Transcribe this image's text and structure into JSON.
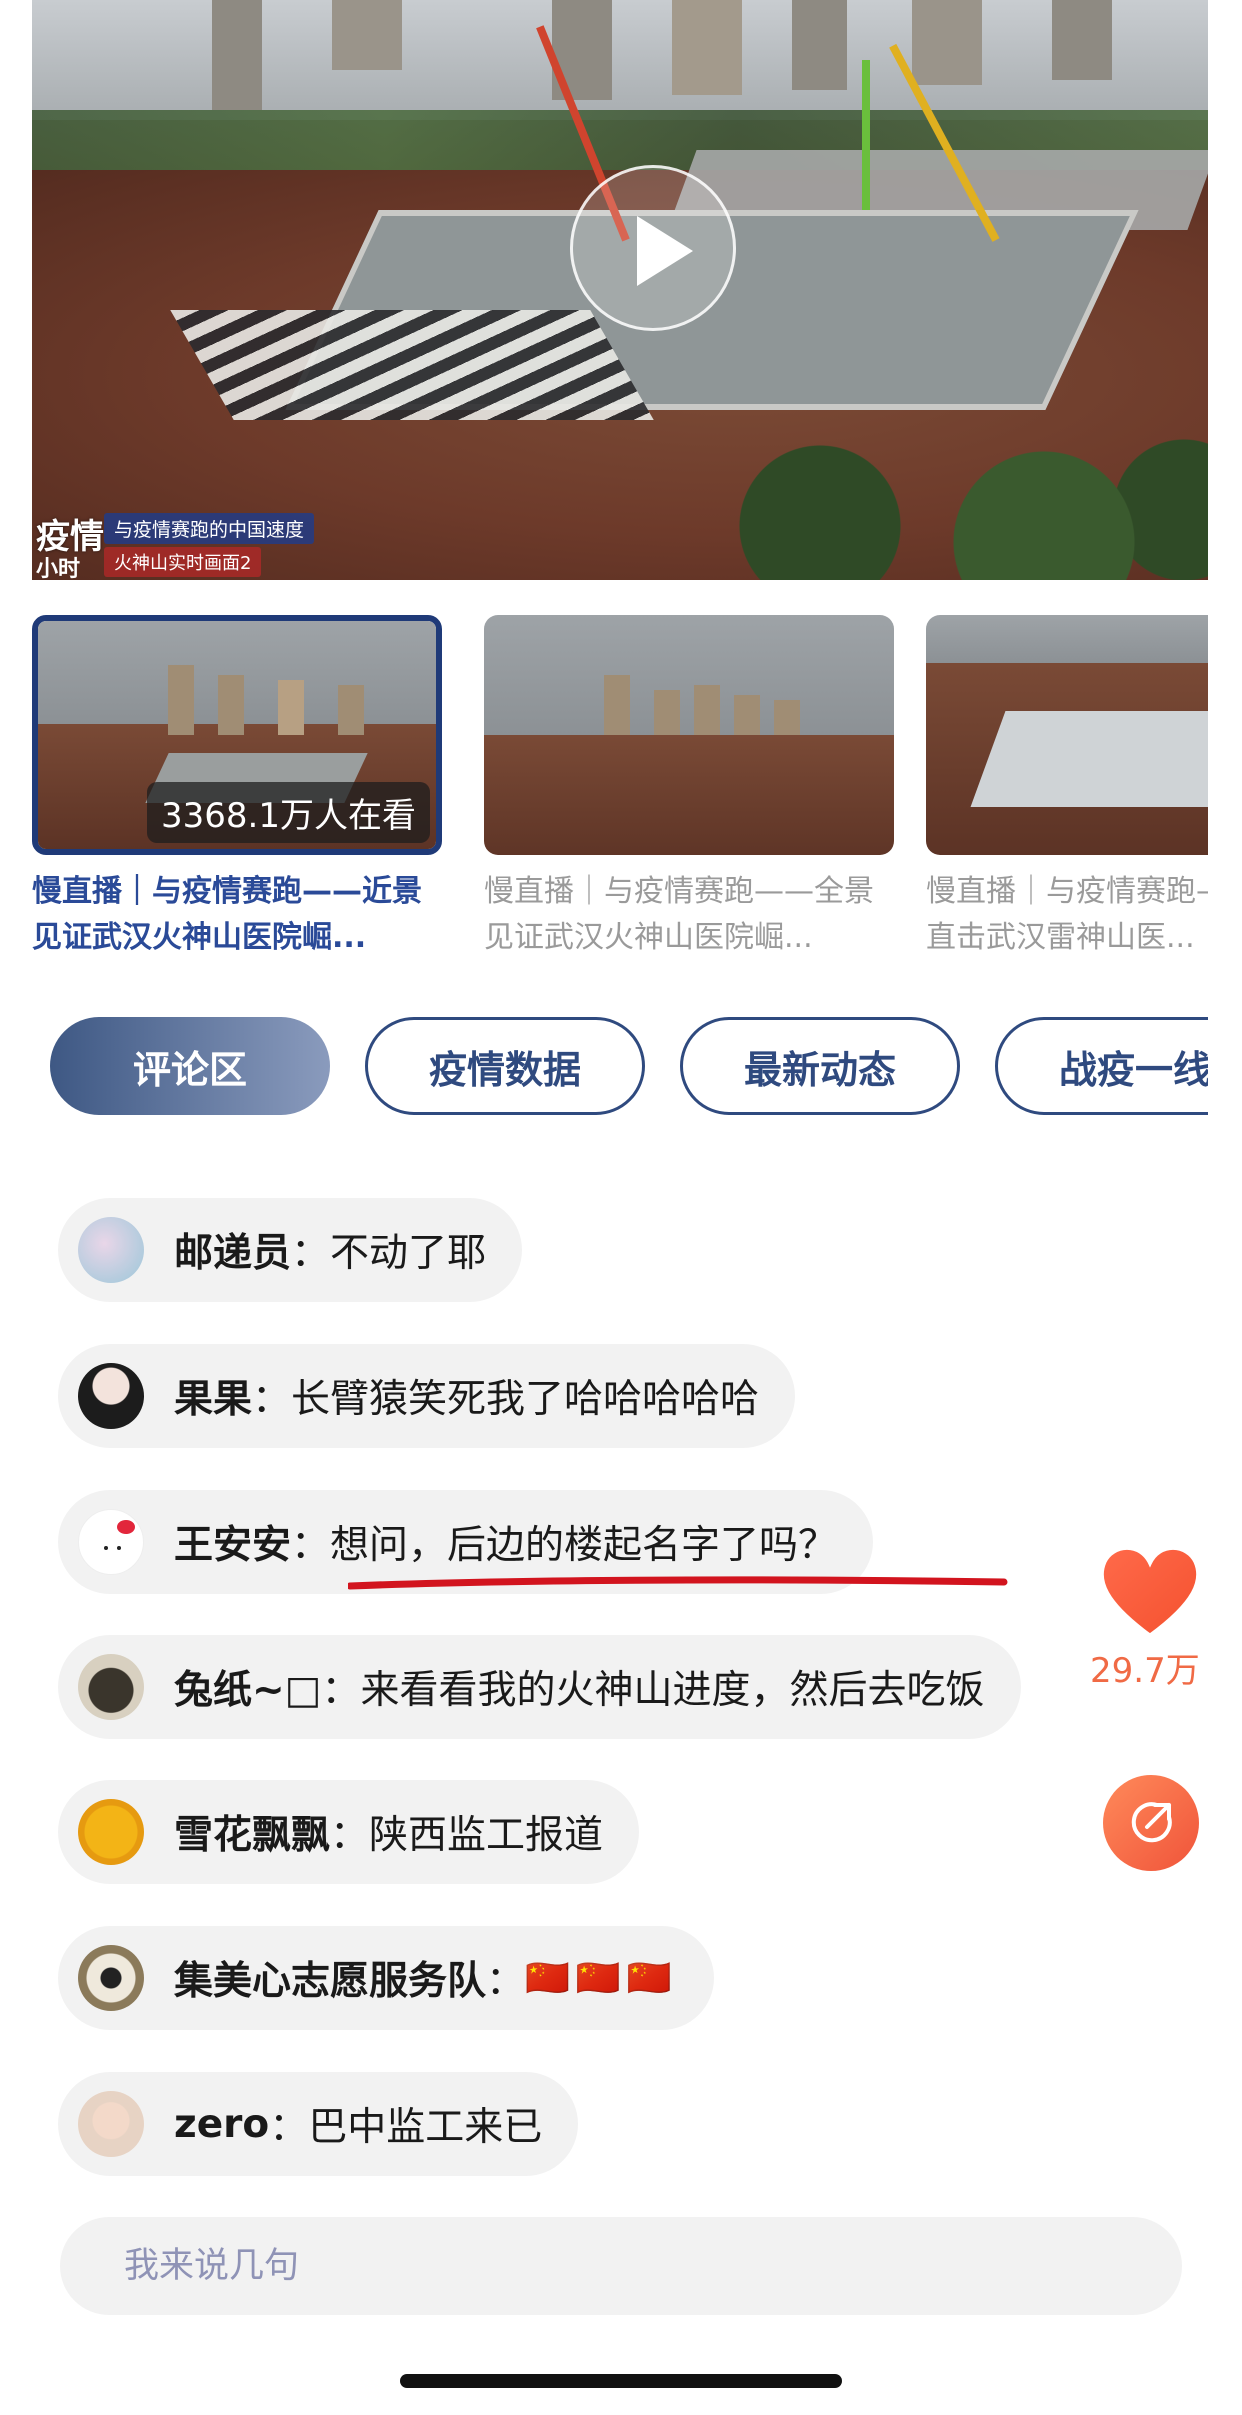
{
  "player": {
    "watermark_title": "疫情",
    "watermark_sub1": "与疫情赛跑的中国速度",
    "watermark_sub2": "火神山实时画面2",
    "watermark_hours": "小时",
    "play_icon": "play-icon"
  },
  "videos": [
    {
      "title": "慢直播｜与疫情赛跑——近景见证武汉火神山医院崛...",
      "viewers": "3368.1万人在看",
      "active": true
    },
    {
      "title": "慢直播｜与疫情赛跑——全景见证武汉火神山医院崛...",
      "viewers": "",
      "active": false
    },
    {
      "title": "慢直播｜与疫情赛跑——全景直击武汉雷神山医...",
      "viewers": "",
      "active": false
    }
  ],
  "tabs": [
    {
      "label": "评论区",
      "active": true
    },
    {
      "label": "疫情数据",
      "active": false
    },
    {
      "label": "最新动态",
      "active": false
    },
    {
      "label": "战疫一线",
      "active": false
    }
  ],
  "comments": [
    {
      "user": "邮递员",
      "sep": "：",
      "text": "不动了耶"
    },
    {
      "user": "果果",
      "sep": "：",
      "text": "长臂猿笑死我了哈哈哈哈哈"
    },
    {
      "user": "王安安",
      "sep": "：",
      "text": "想问，后边的楼起名字了吗？"
    },
    {
      "user": "兔纸~□",
      "sep": " ：",
      "text": "来看看我的火神山进度，然后去吃饭"
    },
    {
      "user": "雪花飘飘",
      "sep": "：",
      "text": "陕西监工报道"
    },
    {
      "user": "集美心志愿服务队",
      "sep": "：",
      "text": "🇨🇳🇨🇳🇨🇳"
    },
    {
      "user": "zero",
      "sep": "：",
      "text": "巴中监工来已"
    }
  ],
  "actions": {
    "like_count": "29.7万",
    "like_icon": "heart-icon",
    "share_icon": "share-icon",
    "like_color": "#f06a45"
  },
  "input": {
    "placeholder": "我来说几句"
  },
  "colors": {
    "accent": "#2f4a7f",
    "active_title": "#2a4a98",
    "share": "#f0543a"
  }
}
